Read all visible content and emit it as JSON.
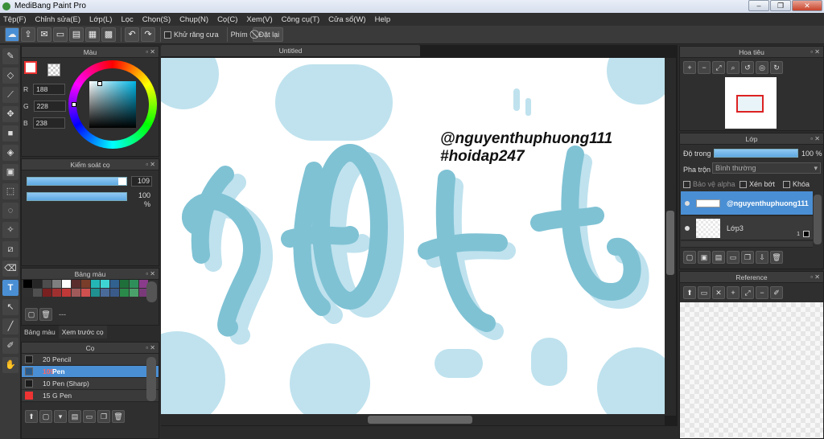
{
  "window": {
    "title": "MediBang Paint Pro",
    "min": "–",
    "max": "❐",
    "close": "✕"
  },
  "menu": [
    "Tệp(F)",
    "Chỉnh sửa(E)",
    "Lớp(L)",
    "Lọc",
    "Chọn(S)",
    "Chụp(N)",
    "Cọ(C)",
    "Xem(V)",
    "Công cụ(T)",
    "Cửa sổ(W)",
    "Help"
  ],
  "toolbar": {
    "antialias_label": "Khử răng cưa",
    "snap_label": "Phím",
    "reset_label": "Đặt lại"
  },
  "color_panel": {
    "title": "Màu",
    "r_label": "R",
    "g_label": "G",
    "b_label": "B",
    "r": "188",
    "g": "228",
    "b": "238",
    "color_hex": "#bce4ee"
  },
  "brush_control": {
    "title": "Kiểm soát cọ",
    "size": "109",
    "opacity": "100 %"
  },
  "palette": {
    "title": "Bảng màu",
    "more": "---",
    "colors": [
      "#000000",
      "#262626",
      "#4d4d4d",
      "#7f7f7f",
      "#ffffff",
      "#5a2c2c",
      "#7a3d2a",
      "#24b5b5",
      "#3fd4d4",
      "#31618f",
      "#1f6f3a",
      "#2f8f5a",
      "#8b3b8b",
      "#303030",
      "#505050",
      "#7a2020",
      "#a03030",
      "#c03838",
      "#a05a5a",
      "#d05050",
      "#209090",
      "#4a6a9a",
      "#3a5a8a",
      "#2a8a4a",
      "#4aa06a",
      "#7a3a7a"
    ]
  },
  "tabs": {
    "palette": "Bảng màu",
    "history": "Xem trước cọ"
  },
  "brush_panel": {
    "title": "Cọ",
    "items": [
      {
        "size": "20",
        "name": "Pencil"
      },
      {
        "size": "109",
        "name": "Pen"
      },
      {
        "size": "10",
        "name": "Pen (Sharp)"
      },
      {
        "size": "15",
        "name": "G Pen"
      }
    ]
  },
  "document": {
    "title": "Untitled"
  },
  "canvas": {
    "handle": "@nguyenthuphuong111",
    "tag": "#hoidap247"
  },
  "navigator": {
    "title": "Hoa tiêu"
  },
  "layer_panel": {
    "title": "Lớp",
    "opacity_label": "Độ trong",
    "opacity_value": "100 %",
    "blend_label": "Pha trộn",
    "blend_value": "Bình thường",
    "protect_alpha": "Bảo vệ alpha",
    "clipping": "Xén bớt",
    "lock": "Khóa",
    "layers": [
      {
        "name": "@nguyenthuphuong111"
      },
      {
        "name": "Lớp3",
        "count": "1"
      }
    ]
  },
  "reference_panel": {
    "title": "Reference"
  }
}
